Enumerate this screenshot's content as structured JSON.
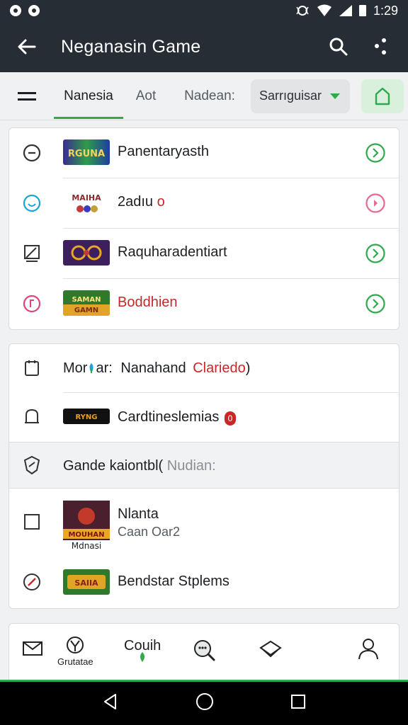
{
  "status_bar": {
    "time": "1:29"
  },
  "app_bar": {
    "title": "Neganasin Game"
  },
  "tabs": {
    "items": [
      {
        "label": "Nanesia",
        "active": true
      },
      {
        "label": "Aot",
        "active": false
      },
      {
        "label": "Nadean:",
        "active": false
      }
    ],
    "dropdown_value": "Sarrıguisar"
  },
  "list_1": [
    {
      "label": "Panentaryasth",
      "lead_icon": "minus-circle-icon",
      "arrow_color": "#2eaa4c"
    },
    {
      "label": "2adıu",
      "suffix": "o",
      "lead_icon": "smile-circle-icon",
      "arrow_color": "#e56b96"
    },
    {
      "label": "Raquharadentiart",
      "lead_icon": "image-icon",
      "arrow_color": "#2eaa4c"
    },
    {
      "label": "Boddhien",
      "lead_icon": "pink-circle-icon",
      "arrow_color": "#2eaa4c"
    }
  ],
  "list_2": {
    "row_1": {
      "prefix": "Mor",
      "middle": "ar:",
      "name": "Nanahand",
      "highlight": "Clariedo",
      "close": ")"
    },
    "row_2": {
      "label": "Cardtineslemias",
      "badge": "0"
    },
    "section": {
      "label": "Gande kaiontbl(",
      "hint": "Nudian:"
    },
    "row_3": {
      "title": "Nlanta",
      "subtitle": "Caan Oar2",
      "thumb_text_top": "MOUHAN",
      "thumb_text_bottom": "Mdnasi"
    },
    "row_4": {
      "label": "Bendstar Stplems"
    }
  },
  "bottom_nav": {
    "items": [
      {
        "label": "",
        "icon": "mail-icon"
      },
      {
        "label": "Grutatae",
        "icon": "shield-icon"
      },
      {
        "label": "Couih",
        "icon": "leaf-icon"
      },
      {
        "label": "",
        "icon": "chat-search-icon"
      },
      {
        "label": "",
        "icon": "chat-icon"
      },
      {
        "label": "",
        "icon": "person-icon"
      }
    ]
  },
  "colors": {
    "accent": "#2eaa4c",
    "app_bar": "#262d34",
    "highlight_red": "#c62828"
  }
}
